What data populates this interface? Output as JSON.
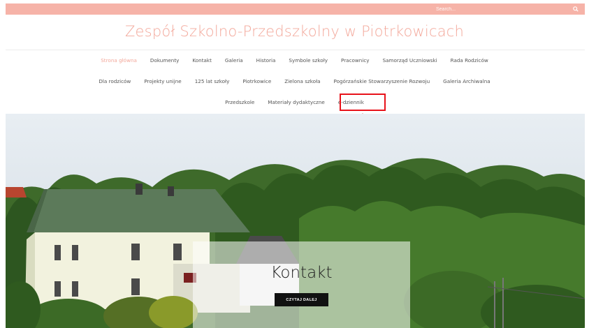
{
  "search": {
    "placeholder": "Search..."
  },
  "site": {
    "title": "Zespół Szkolno-Przedszkolny w Piotrkowicach"
  },
  "nav": {
    "row1": [
      "Strona główna",
      "Dokumenty",
      "Kontakt",
      "Galeria",
      "Historia",
      "Symbole szkoły",
      "Pracownicy",
      "Samorząd Uczniowski",
      "Rada Rodziców"
    ],
    "row2": [
      "Dla rodziców",
      "Projekty unijne",
      "125 lat szkoły",
      "Piotrkowice",
      "Zielona szkoła",
      "Pogórzańskie Stowarzyszenie Rozwoju",
      "Galeria Archiwalna"
    ],
    "row3": [
      "Przedszkole",
      "Materiały dydaktyczne",
      "e-dziennik"
    ],
    "active": "Strona główna"
  },
  "slide": {
    "title": "Kontakt",
    "button": "CZYTAJ DALEJ"
  },
  "colors": {
    "accent": "#f3a89b",
    "topbar": "#f6b3a8",
    "highlight": "#e8121a"
  },
  "icons": {
    "search": "search-icon",
    "annotation": "arrow-up-icon"
  }
}
